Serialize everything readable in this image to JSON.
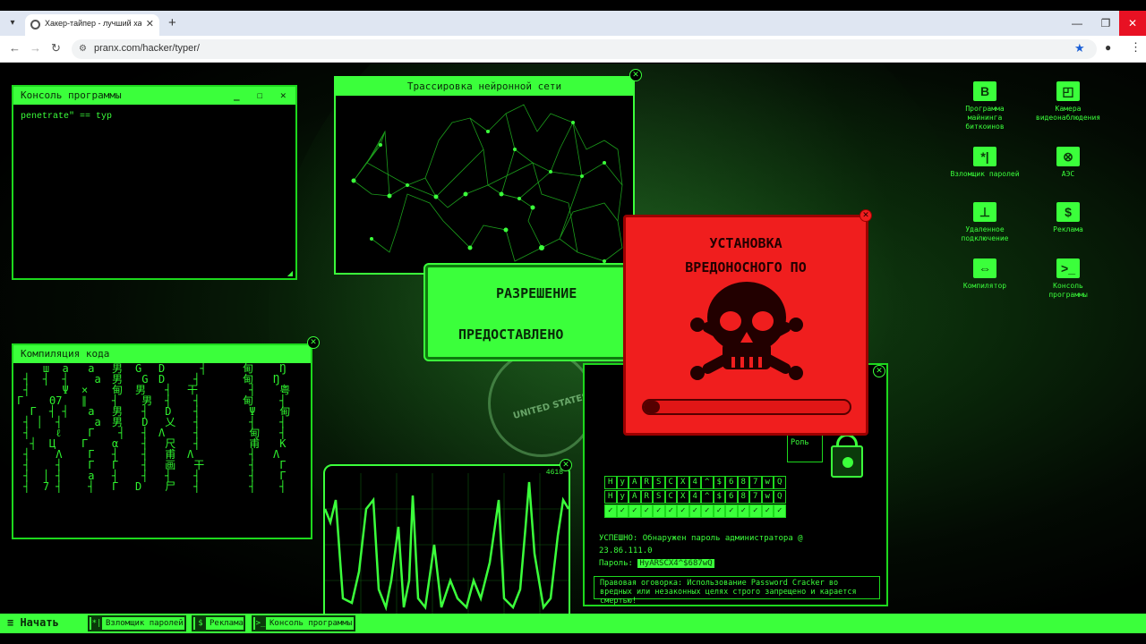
{
  "browser": {
    "tab_title": "Хакер-тайпер - лучший хакер",
    "url": "pranx.com/hacker/typer/",
    "tab_close": "✕",
    "new_tab": "+",
    "win_min": "—",
    "win_max": "❐",
    "win_close": "✕"
  },
  "console_window": {
    "title": "Консоль программы",
    "text": "penetrate\" == typ",
    "min": "_",
    "max": "☐",
    "close": "✕"
  },
  "trace_window": {
    "title": "Трассировка нейронной сети"
  },
  "matrix_window": {
    "title": "Компиляция кода",
    "columns": [
      "    ш\n ┤  ┤\n ┤\nΓ\n  Γ\n ┤ │\n ┤\n  ┤\n ┤\n ┤\n ┤  │\n ┤  7",
      "  a\n  ┤\n  Ψ\nΘ7\n┤ ┤\n ┤\n ℓ\nЦ\n Λ\n ┤\n ┤\n ┤",
      " a\n  a\n× \n∥\n a\n  a\n Γ\nΓ\n Γ\n Γ\n a\n ┤",
      "男\n男\n甸\n┤\n男\n男\n ┤\nα\n┤\nΓ\n┤\nΓ",
      "G\n G\n男\n 男\n ┤\n D\n ┤\n ┤\n ┤\n ┤\n ┤\nD",
      "D\nD\n ┤\n ┤\n D\n 乂\nΛ\n 尺\n 甫\n 画\n ┤\n 尸",
      "  ┤\n ┤\n干\n ┤\n ┤\n ┤\n ┤\n ┤\nΛ\n 干\n ┤\n ┤",
      "甸\n甸\n ┤\n甸\n Ψ\n ┤\n 甸\n 甫\n ┤\n ┤\n ┤\n ┤",
      " Ŋ\nŊ\n 粤\n ┤\n 甸\n ┤\n ┤\n K\nΛ\n Γ\n Γ\n ┤"
    ]
  },
  "granted_window": {
    "line1": "РАЗРЕШЕНИЕ",
    "line2": "ПРЕДОСТАВЛЕНО"
  },
  "malware_window": {
    "line1": "УСТАНОВКА",
    "line2": "ВРЕДОНОСНОГО ПО",
    "progress": 0.04,
    "close": "✕"
  },
  "heart_window": {
    "counter": "4618"
  },
  "cracker_window": {
    "row1": [
      "H",
      "y",
      "A",
      "R",
      "S",
      "C",
      "X",
      "4",
      "^",
      "$",
      "6",
      "8",
      "7",
      "w",
      "Q"
    ],
    "row2": [
      "H",
      "y",
      "A",
      "R",
      "S",
      "C",
      "X",
      "4",
      "^",
      "$",
      "6",
      "8",
      "7",
      "w",
      "Q"
    ],
    "row3": [
      "✓",
      "✓",
      "✓",
      "✓",
      "✓",
      "✓",
      "✓",
      "✓",
      "✓",
      "✓",
      "✓",
      "✓",
      "✓",
      "✓",
      "✓"
    ],
    "success_line1": "УСПЕШНО: Обнаружен пароль администратора @",
    "success_line2": "23.86.111.0",
    "password_label": "Пароль:",
    "password_value": "HyARSCX4^$687wQ",
    "disclaimer": "Правовая оговорка: Использование Password Cracker во вредных или незаконных целях строго запрещено и карается смертью!",
    "role_label": "Роль",
    "close": "✕"
  },
  "desktop_icons": [
    {
      "label": "Программа майнинга биткоинов",
      "glyph": "B"
    },
    {
      "label": "Камера видеонаблюдения",
      "glyph": "◰"
    },
    {
      "label": "Взломщик паролей",
      "glyph": "*|"
    },
    {
      "label": "АЭС",
      "glyph": "⊗"
    },
    {
      "label": "Удаленное подключение",
      "glyph": "⊥"
    },
    {
      "label": "Реклама",
      "glyph": "$"
    },
    {
      "label": "Компилятор",
      "glyph": "⇔"
    },
    {
      "label": "Консоль программы",
      "glyph": ">_"
    }
  ],
  "taskbar": {
    "start": "≡ Начать",
    "items": [
      {
        "label": "Взломщик паролей",
        "glyph": "*|"
      },
      {
        "label": "Реклама",
        "glyph": "$"
      },
      {
        "label": "Консоль программы",
        "glyph": ">_"
      }
    ]
  },
  "colors": {
    "accent": "#3bff3b",
    "alert_red": "#f01e1e",
    "background": "#000000"
  }
}
